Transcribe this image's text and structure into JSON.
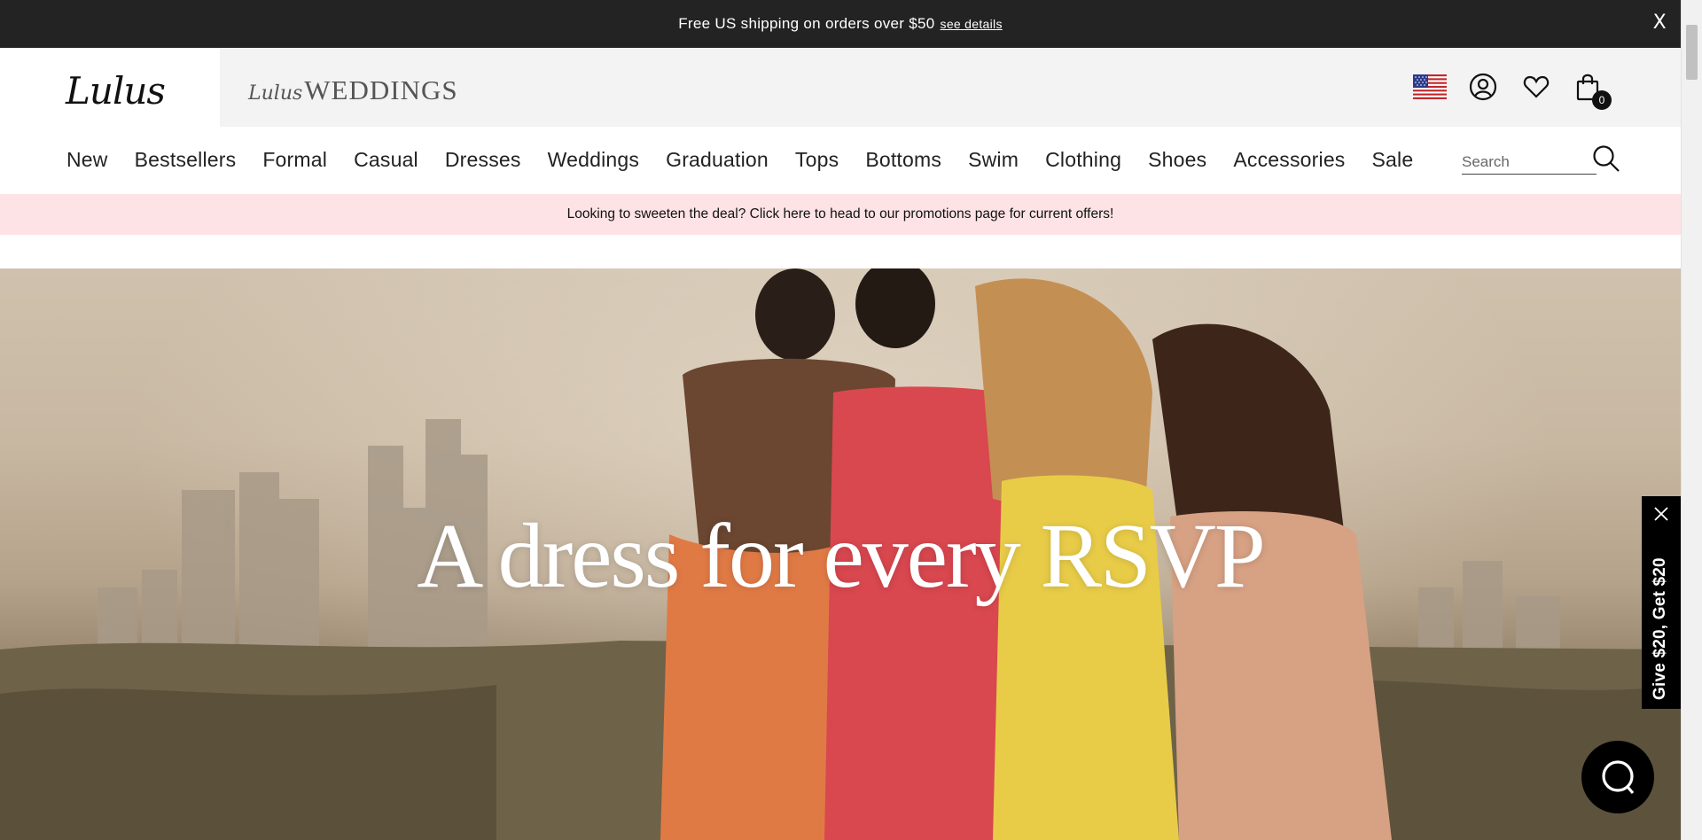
{
  "topbar": {
    "message": "Free US shipping on orders over $50",
    "details_link": "see details",
    "close_label": "X"
  },
  "header": {
    "logo": "Lulus",
    "weddings_logo_script": "Lulus",
    "weddings_logo_caps": "WEDDINGS",
    "icons": [
      "us-flag-icon",
      "account-icon",
      "heart-icon",
      "bag-icon"
    ],
    "cart_count": "0"
  },
  "nav": {
    "items": [
      "New",
      "Bestsellers",
      "Formal",
      "Casual",
      "Dresses",
      "Weddings",
      "Graduation",
      "Tops",
      "Bottoms",
      "Swim",
      "Clothing",
      "Shoes",
      "Accessories",
      "Sale"
    ],
    "search_placeholder": "Search"
  },
  "promo": {
    "text": "Looking to sweeten the deal? Click here to head to our promotions page for current offers!"
  },
  "hero": {
    "headline": "A dress for every RSVP"
  },
  "sidetab": {
    "label": "Give $20, Get $20"
  },
  "colors": {
    "topbar_bg": "#232323",
    "promo_bg": "#fde3e5",
    "weddings_panel_bg": "#f3f3f3"
  }
}
